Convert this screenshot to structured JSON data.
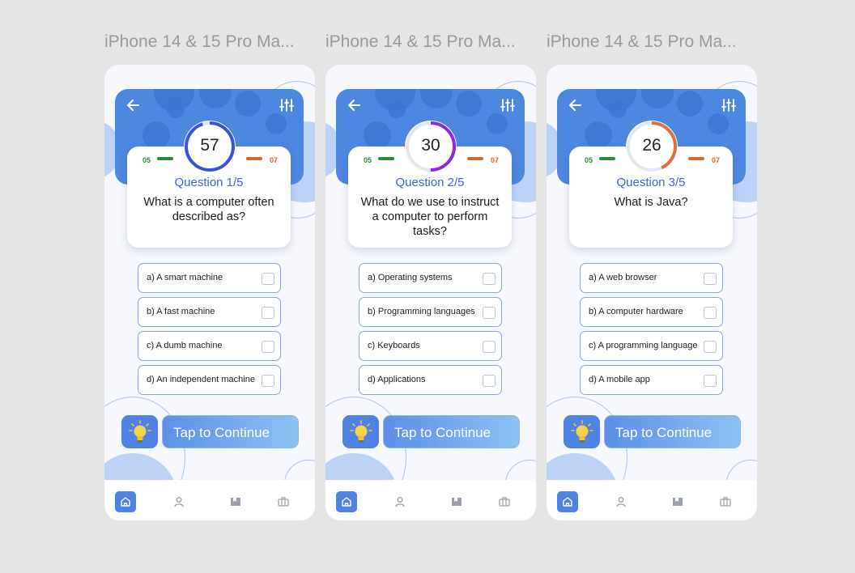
{
  "frames": [
    {
      "title": "iPhone 14 & 15 Pro Ma...",
      "timer": "57",
      "timer_color": "#3a52d8",
      "timer_fraction": 0.95,
      "score_left": "05",
      "score_right": "07",
      "question_number": "Question 1/5",
      "question_text": "What is a computer often described as?",
      "options": [
        "a) A smart machine",
        "b) A fast machine",
        "c) A dumb machine",
        "d) An independent machine"
      ],
      "continue_label": "Tap to Continue"
    },
    {
      "title": "iPhone 14 & 15 Pro Ma...",
      "timer": "30",
      "timer_color": "#8a2be2",
      "timer_fraction": 0.5,
      "score_left": "05",
      "score_right": "07",
      "question_number": "Question 2/5",
      "question_text": "What do we use to instruct a computer to perform tasks?",
      "options": [
        "a) Operating systems",
        "b) Programming languages",
        "c) Keyboards",
        "d) Applications"
      ],
      "continue_label": "Tap to Continue"
    },
    {
      "title": "iPhone 14 & 15 Pro Ma...",
      "timer": "26",
      "timer_color": "#e0703a",
      "timer_fraction": 0.43,
      "score_left": "05",
      "score_right": "07",
      "question_number": "Question 3/5",
      "question_text": "What is Java?",
      "options": [
        "a) A web browser",
        "b) A computer hardware",
        "c) A programming language",
        "d) A mobile app"
      ],
      "continue_label": "Tap to Continue"
    }
  ],
  "icons": {
    "back": "arrow-left-icon",
    "settings": "sliders-icon",
    "hint": "lightbulb-icon",
    "nav": [
      "home-icon",
      "user-icon",
      "book-icon",
      "briefcase-icon"
    ]
  },
  "colors": {
    "header": "#4e87e0",
    "accent": "#3f63d6",
    "score_left": "#2e8a3a",
    "score_right": "#d66a2e",
    "option_border": "#7ea6ec"
  }
}
